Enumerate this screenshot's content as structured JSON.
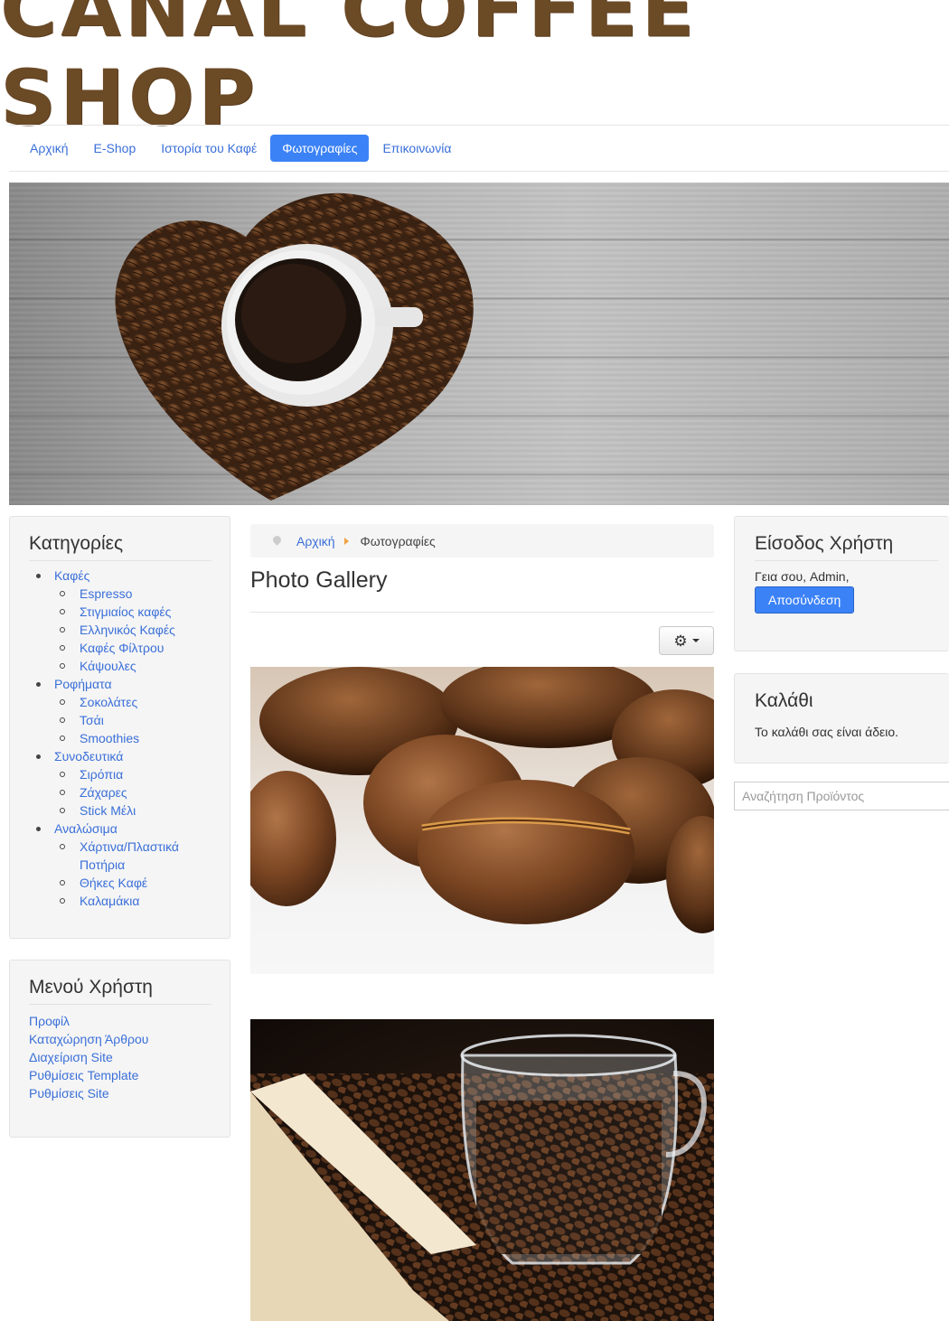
{
  "site": {
    "title": "CANAL COFFEE SHOP"
  },
  "nav": {
    "items": [
      {
        "label": "Αρχική"
      },
      {
        "label": "E-Shop"
      },
      {
        "label": "Ιστορία του Καφέ"
      },
      {
        "label": "Φωτογραφίες"
      },
      {
        "label": "Επικοινωνία"
      }
    ],
    "active_index": 3
  },
  "colors": {
    "brand": "#6b4a26",
    "accent": "#3b82f6",
    "link": "#3a6fd8"
  },
  "categories": {
    "title": "Κατηγορίες",
    "groups": [
      {
        "label": "Καφές",
        "children": [
          "Espresso",
          "Στιγμιαίος καφές",
          "Ελληνικός Καφές",
          "Καφές Φίλτρου",
          "Κάψουλες"
        ]
      },
      {
        "label": "Ροφήματα",
        "children": [
          "Σοκολάτες",
          "Τσάι",
          "Smoothies"
        ]
      },
      {
        "label": "Συνοδευτικά",
        "children": [
          "Σιρόπια",
          "Ζάχαρες",
          "Stick Μέλι"
        ]
      },
      {
        "label": "Αναλώσιμα",
        "children": [
          "Χάρτινα/Πλαστικά Ποτήρια",
          "Θήκες Καφέ",
          "Καλαμάκια"
        ]
      }
    ]
  },
  "user_menu": {
    "title": "Μενού Χρήστη",
    "items": [
      "Προφίλ",
      "Καταχώρηση Άρθρου",
      "Διαχείριση Site",
      "Ρυθμίσεις Template",
      "Ρυθμίσεις Site"
    ]
  },
  "breadcrumb": {
    "home": "Αρχική",
    "current": "Φωτογραφίες"
  },
  "main": {
    "title": "Photo Gallery",
    "tools_icon": "gear-icon"
  },
  "login": {
    "title": "Είσοδος Χρήστη",
    "greeting": "Γεια σου, Admin,",
    "logout_label": "Αποσύνδεση"
  },
  "cart": {
    "title": "Καλάθι",
    "empty_text": "Το καλάθι σας είναι άδειο."
  },
  "search": {
    "placeholder": "Αναζήτηση Προϊόντος"
  }
}
